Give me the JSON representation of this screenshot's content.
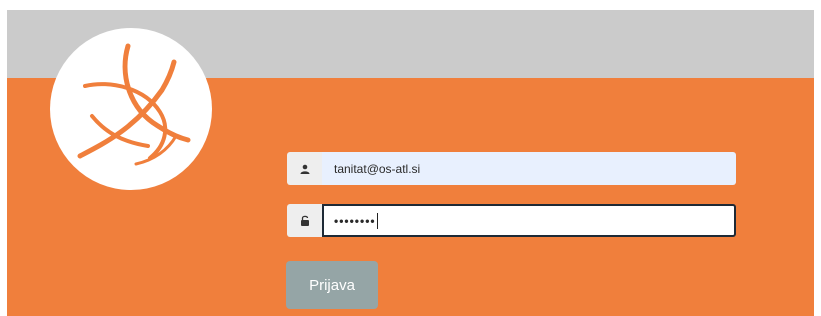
{
  "colors": {
    "top_band": "#cbcbcb",
    "panel": "#f07f3c",
    "logo_stroke": "#f07f3c",
    "button": "#95a5a6",
    "email_field_bg": "#e8f0fe",
    "password_field_border": "#1e2a36"
  },
  "logo": {
    "icon": "orbit-swirl-logo"
  },
  "login": {
    "email_icon": "user-icon",
    "email_value": "tanitat@os-atl.si",
    "password_icon": "unlock-icon",
    "password_value": "••••••••",
    "submit_label": "Prijava"
  }
}
